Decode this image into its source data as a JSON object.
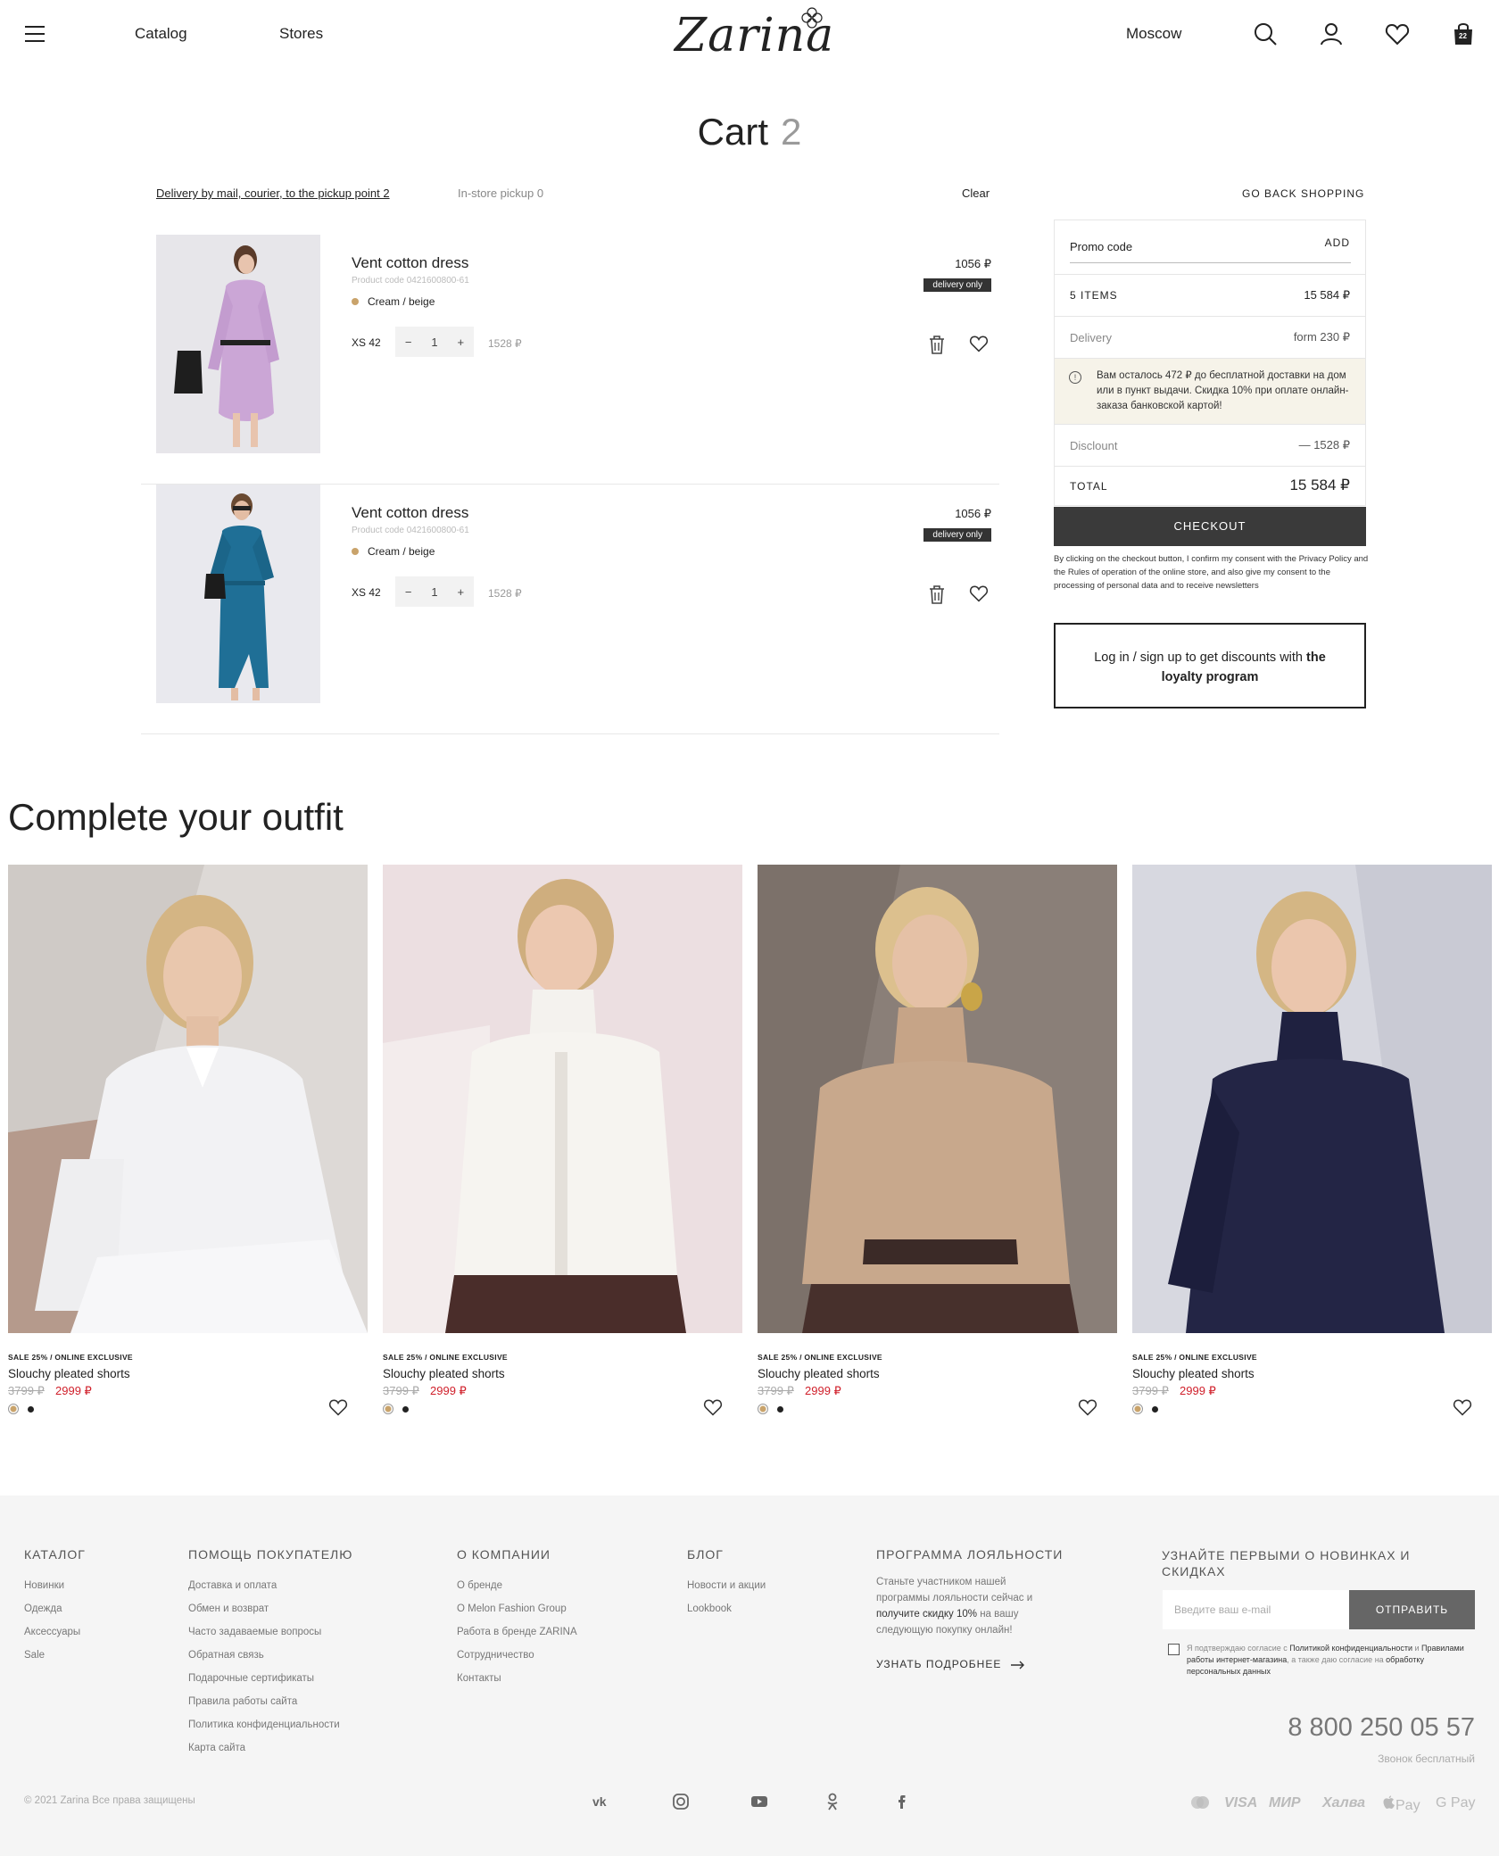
{
  "header": {
    "nav": [
      "Catalog",
      "Stores"
    ],
    "logo": "Zarina",
    "city": "Moscow",
    "cart_count": "22"
  },
  "cart": {
    "title": "Cart",
    "count": "2",
    "tab_delivery": "Delivery by mail, courier, to the pickup point 2",
    "tab_pickup": "In-store pickup 0",
    "clear": "Clear",
    "back": "GO BACK SHOPPING",
    "items": [
      {
        "name": "Vent cotton dress",
        "code": "Product code 0421600800-61",
        "color": "Cream / beige",
        "size": "XS 42",
        "qty": "1",
        "minus": "−",
        "plus": "+",
        "subtotal": "1528 ₽",
        "price": "1056 ₽",
        "badge": "delivery only"
      },
      {
        "name": "Vent cotton dress",
        "code": "Product code 0421600800-61",
        "color": "Cream / beige",
        "size": "XS 42",
        "qty": "1",
        "minus": "−",
        "plus": "+",
        "subtotal": "1528 ₽",
        "price": "1056 ₽",
        "badge": "delivery only"
      }
    ]
  },
  "summary": {
    "promo_placeholder": "Promo code",
    "promo_add": "ADD",
    "items_label": "5 ITEMS",
    "items_value": "15 584 ₽",
    "delivery_label": "Delivery",
    "delivery_value": "form 230 ₽",
    "notice": "Вам осталось 472 ₽ до бесплатной доставки на дом или в пункт выдачи. Скидка 10% при оплате онлайн-заказа банковской картой!",
    "discount_label": "Disclount",
    "discount_value": "— 1528 ₽",
    "total_label": "TOTAL",
    "total_value": "15 584 ₽",
    "checkout": "CHECKOUT",
    "consent": "By clicking on the checkout button, I confirm my consent with the Privacy Policy and the Rules of operation of the online store, and also give my consent to the processing of personal data and to receive newsletters",
    "loyalty_plain": "Log in / sign up to get discounts with ",
    "loyalty_bold": "the loyalty program"
  },
  "outfit": {
    "title": "Complete your outfit",
    "products": [
      {
        "tag": "SALE 25% / ONLINE EXCLUSIVE",
        "name": "Slouchy pleated shorts",
        "old_price": "3799 ₽",
        "new_price": "2999 ₽"
      },
      {
        "tag": "SALE 25% / ONLINE EXCLUSIVE",
        "name": "Slouchy pleated shorts",
        "old_price": "3799 ₽",
        "new_price": "2999 ₽"
      },
      {
        "tag": "SALE 25% / ONLINE EXCLUSIVE",
        "name": "Slouchy pleated shorts",
        "old_price": "3799 ₽",
        "new_price": "2999 ₽"
      },
      {
        "tag": "SALE 25% / ONLINE EXCLUSIVE",
        "name": "Slouchy pleated shorts",
        "old_price": "3799 ₽",
        "new_price": "2999 ₽"
      }
    ]
  },
  "footer": {
    "catalog": {
      "title": "КАТАЛОГ",
      "links": [
        "Новинки",
        "Одежда",
        "Аксессуары",
        "Sale"
      ]
    },
    "help": {
      "title": "ПОМОЩЬ ПОКУПАТЕЛЮ",
      "links": [
        "Доставка и оплата",
        "Обмен и возврат",
        "Часто задаваемые вопросы",
        "Обратная связь",
        "Подарочные сертификаты",
        "Правила работы сайта",
        "Политика конфиденциальности",
        "Карта сайта"
      ]
    },
    "company": {
      "title": "О КОМПАНИИ",
      "links": [
        "О бренде",
        "О Melon Fashion Group",
        "Работа в бренде ZARINA",
        "Сотрудничество",
        "Контакты"
      ]
    },
    "blog": {
      "title": "БЛОГ",
      "links": [
        "Новости и акции",
        "Lookbook"
      ]
    },
    "loyalty": {
      "title": "ПРОГРАММА ЛОЯЛЬНОСТИ",
      "text_1": "Станьте участником нашей программы лояльности сейчас и ",
      "text_bold": "получите скидку 10%",
      "text_2": " на вашу следующую покупку онлайн!",
      "more": "УЗНАТЬ ПОДРОБНЕЕ"
    },
    "subscribe": {
      "title": "УЗНАЙТЕ ПЕРВЫМИ О НОВИНКАХ И СКИДКАХ",
      "placeholder": "Введите ваш e-mail",
      "button": "ОТПРАВИТЬ",
      "consent_1": "Я подтверждаю согласие с ",
      "consent_link_1": "Политикой конфиденциальности",
      "consent_2": " и ",
      "consent_link_2": "Правилами работы интернет-магазина",
      "consent_3": ", а также даю согласие на ",
      "consent_link_3": "обработку персональных данных"
    },
    "phone": "8 800 250 05 57",
    "phone_note": "Звонок бесплатный",
    "copyright": "© 2021 Zarina Все права защищены",
    "payments": [
      "VISA",
      "МИР",
      "Халва",
      "Pay",
      "G Pay"
    ]
  }
}
